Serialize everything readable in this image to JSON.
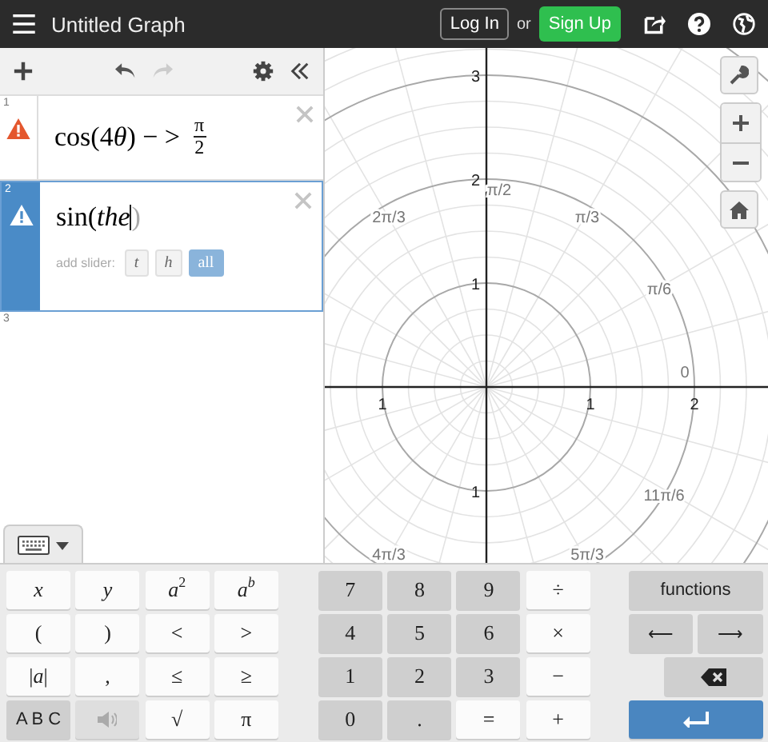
{
  "header": {
    "title": "Untitled Graph",
    "login": "Log In",
    "or": "or",
    "signup": "Sign Up"
  },
  "toolbar": {
    "redo_disabled": true
  },
  "expressions": [
    {
      "number": "1",
      "warning": true,
      "selected": false,
      "math": [
        {
          "text": "cos(4",
          "italic": false
        },
        {
          "text": "θ",
          "italic": true
        },
        {
          "text": ") − >",
          "italic": false
        }
      ],
      "fraction": {
        "numerator": "π",
        "denominator": "2"
      }
    },
    {
      "number": "2",
      "warning": true,
      "selected": true,
      "math": [
        {
          "text": "sin(",
          "italic": false
        },
        {
          "text": "the",
          "italic": true
        }
      ],
      "cursor": true,
      "closing": ")",
      "slider": {
        "label": "add slider:",
        "options": [
          {
            "text": "t",
            "selected": false
          },
          {
            "text": "h",
            "selected": false
          },
          {
            "text": "all",
            "selected": true
          }
        ]
      }
    },
    {
      "number": "3",
      "warning": false,
      "selected": false
    }
  ],
  "graph": {
    "y_ticks": [
      "3",
      "2",
      "1",
      "1"
    ],
    "x_ticks": [
      "1",
      "1",
      "2"
    ],
    "angle_labels": [
      "π/2",
      "2π/3",
      "π/3",
      "π/6",
      "0",
      "11π/6",
      "4π/3",
      "5π/3"
    ]
  },
  "keyboard": {
    "open": true
  },
  "keypad": {
    "blocks": [
      {
        "keys": [
          {
            "kind": "light",
            "segments": [
              {
                "text": "x",
                "italic": true
              }
            ]
          },
          {
            "kind": "light",
            "segments": [
              {
                "text": "y",
                "italic": true
              }
            ]
          },
          {
            "kind": "light",
            "segments": [
              {
                "text": "a",
                "italic": true
              },
              {
                "text": "2",
                "raised": true
              }
            ]
          },
          {
            "kind": "light",
            "segments": [
              {
                "text": "a",
                "italic": true
              },
              {
                "text": "b",
                "italic": true,
                "raised": true
              }
            ]
          },
          {
            "kind": "light",
            "segments": [
              {
                "text": "("
              }
            ]
          },
          {
            "kind": "light",
            "segments": [
              {
                "text": ")"
              }
            ]
          },
          {
            "kind": "light",
            "segments": [
              {
                "text": "<"
              }
            ]
          },
          {
            "kind": "light",
            "segments": [
              {
                "text": ">"
              }
            ]
          },
          {
            "kind": "light",
            "segments": [
              {
                "text": "|"
              },
              {
                "text": "a",
                "italic": true
              },
              {
                "text": "|"
              }
            ]
          },
          {
            "kind": "light",
            "segments": [
              {
                "text": ","
              }
            ]
          },
          {
            "kind": "light",
            "segments": [
              {
                "text": "≤"
              }
            ]
          },
          {
            "kind": "light",
            "segments": [
              {
                "text": "≥"
              }
            ]
          },
          {
            "kind": "dark",
            "segments": [
              {
                "text": "A B C"
              }
            ]
          },
          {
            "kind": "speaker"
          },
          {
            "kind": "light",
            "segments": [
              {
                "text": "√"
              }
            ]
          },
          {
            "kind": "light",
            "segments": [
              {
                "text": "π"
              }
            ]
          }
        ]
      },
      {
        "keys": [
          {
            "kind": "dark",
            "segments": [
              {
                "text": "7"
              }
            ]
          },
          {
            "kind": "dark",
            "segments": [
              {
                "text": "8"
              }
            ]
          },
          {
            "kind": "dark",
            "segments": [
              {
                "text": "9"
              }
            ]
          },
          {
            "kind": "light",
            "segments": [
              {
                "text": "÷"
              }
            ]
          },
          {
            "kind": "dark",
            "segments": [
              {
                "text": "4"
              }
            ]
          },
          {
            "kind": "dark",
            "segments": [
              {
                "text": "5"
              }
            ]
          },
          {
            "kind": "dark",
            "segments": [
              {
                "text": "6"
              }
            ]
          },
          {
            "kind": "light",
            "segments": [
              {
                "text": "×"
              }
            ]
          },
          {
            "kind": "dark",
            "segments": [
              {
                "text": "1"
              }
            ]
          },
          {
            "kind": "dark",
            "segments": [
              {
                "text": "2"
              }
            ]
          },
          {
            "kind": "dark",
            "segments": [
              {
                "text": "3"
              }
            ]
          },
          {
            "kind": "light",
            "segments": [
              {
                "text": "−"
              }
            ]
          },
          {
            "kind": "dark",
            "segments": [
              {
                "text": "0"
              }
            ]
          },
          {
            "kind": "dark",
            "segments": [
              {
                "text": "."
              }
            ]
          },
          {
            "kind": "light",
            "segments": [
              {
                "text": "="
              }
            ]
          },
          {
            "kind": "light",
            "segments": [
              {
                "text": "+"
              }
            ]
          }
        ]
      },
      {
        "keys": [
          {
            "kind": "dark",
            "segments": [
              {
                "text": "functions"
              }
            ]
          },
          {
            "kind": "dark",
            "segments": [
              {
                "text": "⟵"
              }
            ]
          },
          {
            "kind": "dark",
            "segments": [
              {
                "text": "⟶"
              }
            ]
          },
          {
            "kind": "backspace"
          },
          {
            "kind": "enter"
          }
        ]
      }
    ]
  }
}
